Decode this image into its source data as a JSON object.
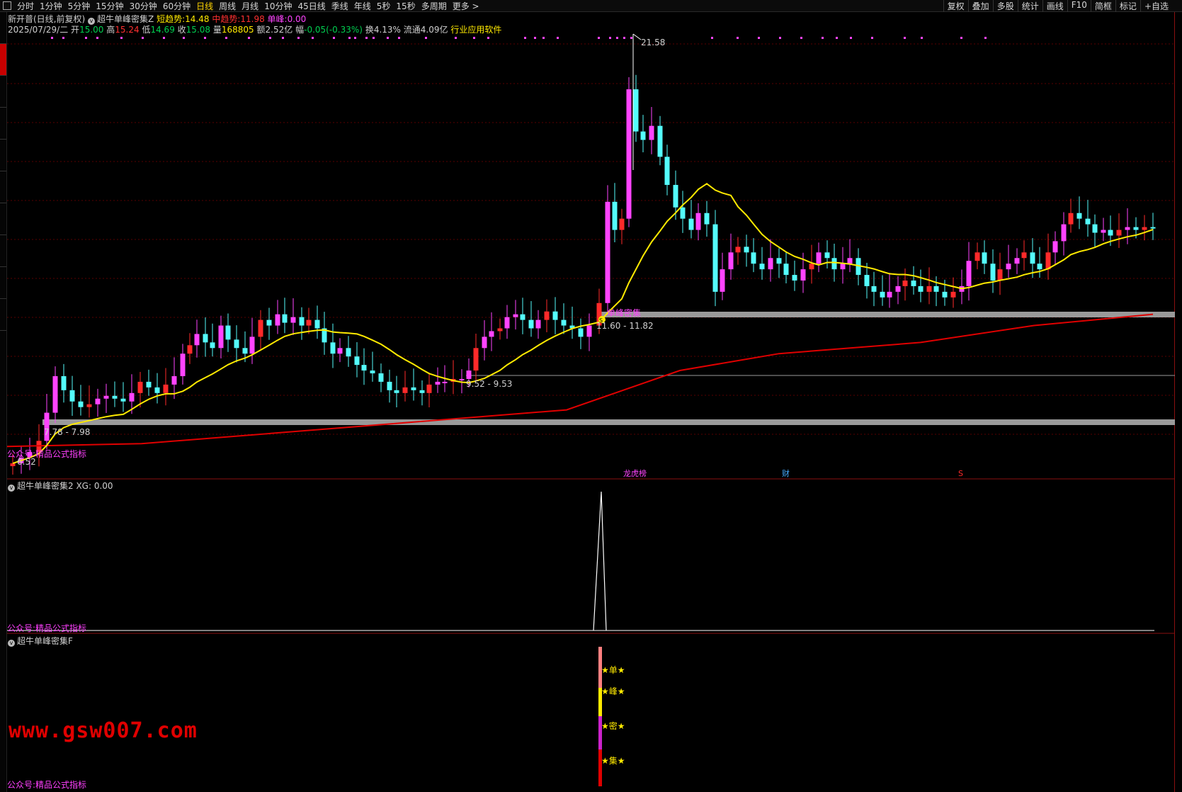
{
  "toolbar": {
    "periods": [
      "分时",
      "1分钟",
      "5分钟",
      "15分钟",
      "30分钟",
      "60分钟",
      "日线",
      "周线",
      "月线",
      "10分钟",
      "45日线",
      "季线",
      "年线",
      "5秒",
      "15秒",
      "多周期",
      "更多 >"
    ],
    "active_period": "日线",
    "tools": [
      "复权",
      "叠加",
      "多股",
      "统计",
      "画线",
      "F10",
      "简框",
      "标记",
      "+自选"
    ]
  },
  "header": {
    "stock_name": "新开普(日线,前复权)",
    "indicator": "超牛单峰密集Z",
    "short_label": "短趋势:",
    "short_value": "14.48",
    "mid_label": "中趋势:",
    "mid_value": "11.98",
    "peak_label": "单峰:",
    "peak_value": "0.00",
    "date": "2025/07/29/二",
    "open_label": "开",
    "open": "15.00",
    "high_label": "高",
    "high": "15.24",
    "low_label": "低",
    "low": "14.69",
    "close_label": "收",
    "close": "15.08",
    "vol_label": "量",
    "vol": "168805",
    "amt_label": "额",
    "amt": "2.52亿",
    "chg_label": "幅",
    "chg": "-0.05(-0.33%)",
    "turn_label": "换",
    "turn": "4.13%",
    "float_label": "流通",
    "float": "4.09亿",
    "industry": "行业应用软件"
  },
  "main_chart": {
    "price_high": "21.58",
    "price_low": "6.52",
    "band_high_label": "11.60 - 11.82",
    "band_mid_label": "9.52 - 9.53",
    "band_low_label": "7.78 - 7.98",
    "signal_label": "单峰密集",
    "signal_icon": "S",
    "events": [
      "龙虎榜",
      "财",
      "S"
    ],
    "watermark": "公众号:精品公式指标"
  },
  "sub1": {
    "title": "超牛单峰密集2 XG: 0.00",
    "watermark": "公众号:精品公式指标"
  },
  "sub2": {
    "title": "超牛单峰密集F",
    "stars": [
      "★单★",
      "★峰★",
      "★密★",
      "★集★"
    ],
    "watermark": "公众号:精品公式指标"
  },
  "site_watermark": "www.gsw007.com",
  "colors": {
    "up": "#ff2a2a",
    "up_hollow": "#ff44ff",
    "down": "#54fcfc",
    "ma_short": "#ffea00",
    "ma_long": "#e00000",
    "band": "#9a9a9a"
  }
}
